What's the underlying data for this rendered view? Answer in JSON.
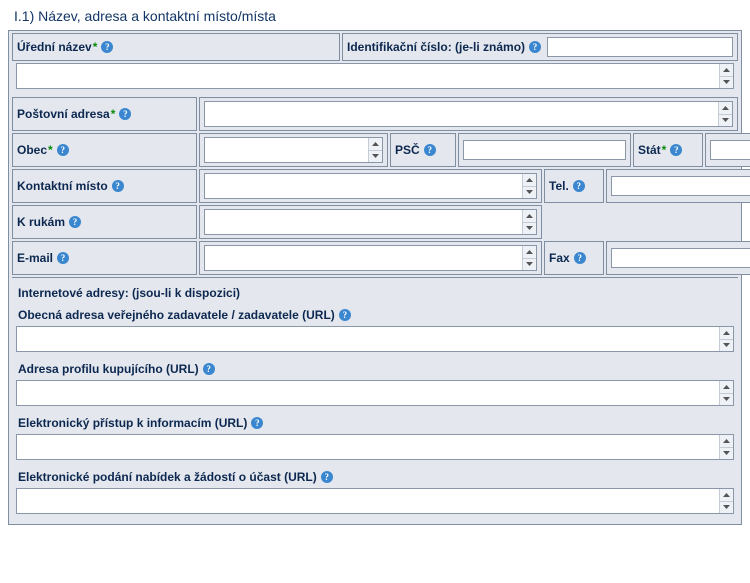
{
  "section_title": "I.1) Název, adresa a kontaktní místo/místa",
  "labels": {
    "official_name": "Úřední název",
    "id_number": "Identifikační číslo: (je-li známo)",
    "postal_address": "Poštovní adresa",
    "city": "Obec",
    "zip": "PSČ",
    "country": "Stát",
    "contact_point": "Kontaktní místo",
    "tel": "Tel.",
    "attention": "K rukám",
    "email": "E-mail",
    "fax": "Fax",
    "internet_heading": "Internetové adresy: (jsou-li k dispozici)",
    "url_general": "Obecná adresa veřejného zadavatele / zadavatele (URL)",
    "url_buyer": "Adresa profilu kupujícího (URL)",
    "url_einfo": "Elektronický přístup k informacím (URL)",
    "url_esubmit": "Elektronické podání nabídek a žádostí o účast (URL)"
  },
  "required": {
    "mark": "*"
  },
  "help_glyph": "?",
  "values": {
    "official_name": "",
    "id_number": "",
    "postal_address": "",
    "city": "",
    "zip": "",
    "country": "",
    "contact_point": "",
    "tel": "",
    "attention": "",
    "email": "",
    "fax": "",
    "url_general": "",
    "url_buyer": "",
    "url_einfo": "",
    "url_esubmit": ""
  }
}
